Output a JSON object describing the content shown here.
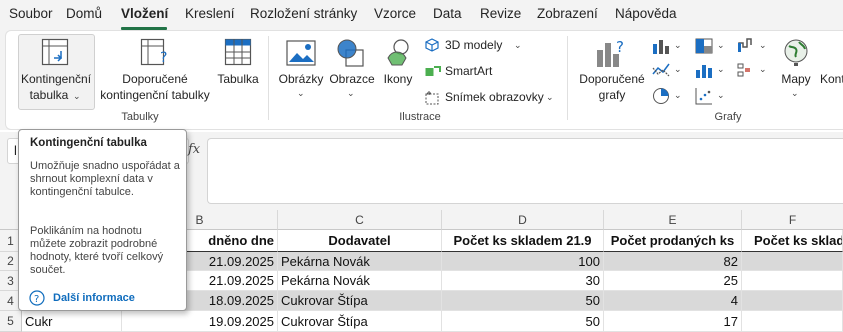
{
  "menu": {
    "items": [
      "Soubor",
      "Domů",
      "Vložení",
      "Kreslení",
      "Rozložení stránky",
      "Vzorce",
      "Data",
      "Revize",
      "Zobrazení",
      "Nápověda"
    ],
    "active": "Vložení",
    "accent_color": "#217346"
  },
  "ribbon": {
    "tables": {
      "pivot_line1": "Kontingenční",
      "pivot_line2": "tabulka",
      "recommended_line1": "Doporučené",
      "recommended_line2": "kontingenční tabulky",
      "table": "Tabulka",
      "group_label": "Tabulky"
    },
    "illustrations": {
      "pictures": "Obrázky",
      "shapes": "Obrazce",
      "icons": "Ikony",
      "models3d": "3D modely",
      "smartart": "SmartArt",
      "screenshot": "Snímek obrazovky",
      "group_label": "Ilustrace"
    },
    "charts": {
      "recommended_line1": "Doporučené",
      "recommended_line2": "grafy",
      "maps": "Mapy",
      "pivotchart_partial": "Konti",
      "group_label": "Grafy"
    }
  },
  "formula": {
    "fx": "fx",
    "namebox_partial": "l"
  },
  "tooltip": {
    "title": "Kontingenční tabulka",
    "body1": "Umožňuje snadno uspořádat a shrnout komplexní data v kontingenční tabulce.",
    "body2": "Poklikáním na hodnotu můžete zobrazit podrobné hodnoty, které tvoří celkový součet.",
    "link": "Další informace",
    "link_color": "#0f6cbd"
  },
  "grid": {
    "columns": [
      "B",
      "C",
      "D",
      "E",
      "F"
    ],
    "rows": [
      "2",
      "3",
      "4",
      "5"
    ],
    "header_row_num": "1",
    "headers": {
      "b": "dněno dne",
      "c": "Dodavatel",
      "d": "Počet ks skladem 21.9",
      "e": "Počet prodaných ks",
      "f": "Počet ks sklad"
    },
    "data": [
      {
        "a": "",
        "b": "21.09.2025",
        "c": "Pekárna Novák",
        "d": "100",
        "e": "82",
        "f": ""
      },
      {
        "a": "",
        "b": "21.09.2025",
        "c": "Pekárna Novák",
        "d": "30",
        "e": "25",
        "f": ""
      },
      {
        "a": "",
        "b": "18.09.2025",
        "c": "Cukrovar Štípa",
        "d": "50",
        "e": "4",
        "f": ""
      },
      {
        "a": "Cukr",
        "b": "19.09.2025",
        "c": "Cukrovar Štípa",
        "d": "50",
        "e": "17",
        "f": ""
      }
    ]
  }
}
